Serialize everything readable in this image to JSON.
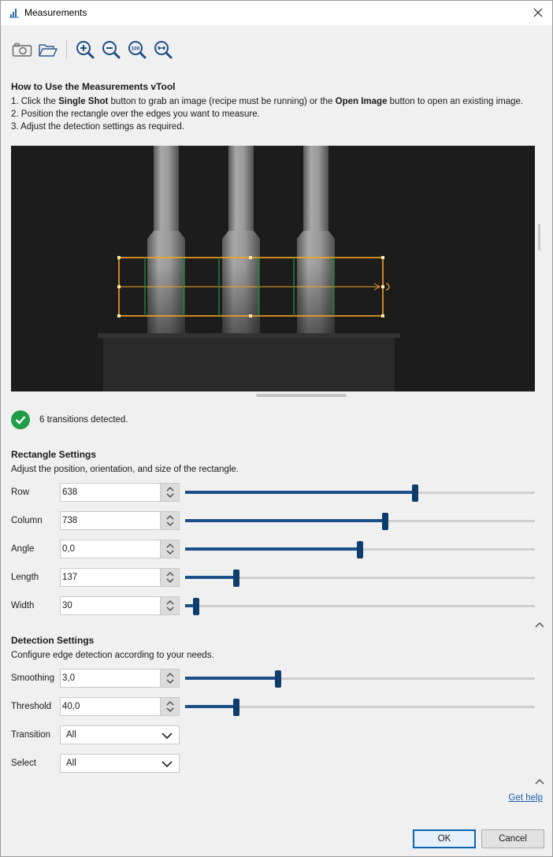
{
  "window": {
    "title": "Measurements"
  },
  "toolbar": {
    "buttons": [
      {
        "icon": "camera-icon"
      },
      {
        "icon": "open-folder-icon"
      },
      {
        "icon": "zoom-in-icon"
      },
      {
        "icon": "zoom-out-icon"
      },
      {
        "icon": "zoom-100-icon",
        "text": "100"
      },
      {
        "icon": "zoom-fit-icon"
      }
    ]
  },
  "howto": {
    "title": "How to Use the Measurements vTool",
    "step1_a": "1. Click the ",
    "step1_b": "Single Shot",
    "step1_c": " button to grab an image (recipe must be running) or the ",
    "step1_d": "Open Image",
    "step1_e": " button to open an existing image.",
    "step2": "2. Position the rectangle over the edges you want to measure.",
    "step3": "3. Adjust the detection settings as required."
  },
  "status": {
    "text": "6 transitions detected.",
    "color": "#1f9d49"
  },
  "rectangle_settings": {
    "title": "Rectangle Settings",
    "description": "Adjust the position, orientation, and size of the rectangle.",
    "fields": [
      {
        "label": "Row",
        "value": "638",
        "slider": 0.658
      },
      {
        "label": "Column",
        "value": "738",
        "slider": 0.572
      },
      {
        "label": "Angle",
        "value": "0,0",
        "slider": 0.5
      },
      {
        "label": "Length",
        "value": "137",
        "slider": 0.147
      },
      {
        "label": "Width",
        "value": "30",
        "slider": 0.032
      }
    ]
  },
  "detection_settings": {
    "title": "Detection Settings",
    "description": "Configure edge detection according to your needs.",
    "fields": [
      {
        "label": "Smoothing",
        "value": "3,0",
        "slider": 0.266
      },
      {
        "label": "Threshold",
        "value": "40,0",
        "slider": 0.147
      }
    ],
    "dropdowns": [
      {
        "label": "Transition",
        "value": "All"
      },
      {
        "label": "Select",
        "value": "All"
      }
    ]
  },
  "help": {
    "label": "Get help"
  },
  "footer": {
    "ok_label": "OK",
    "cancel_label": "Cancel"
  },
  "colors": {
    "accent": "#0e3c6c",
    "roi": "#f5a623",
    "edge": "#1d8a3a",
    "link": "#1a5fa8"
  }
}
